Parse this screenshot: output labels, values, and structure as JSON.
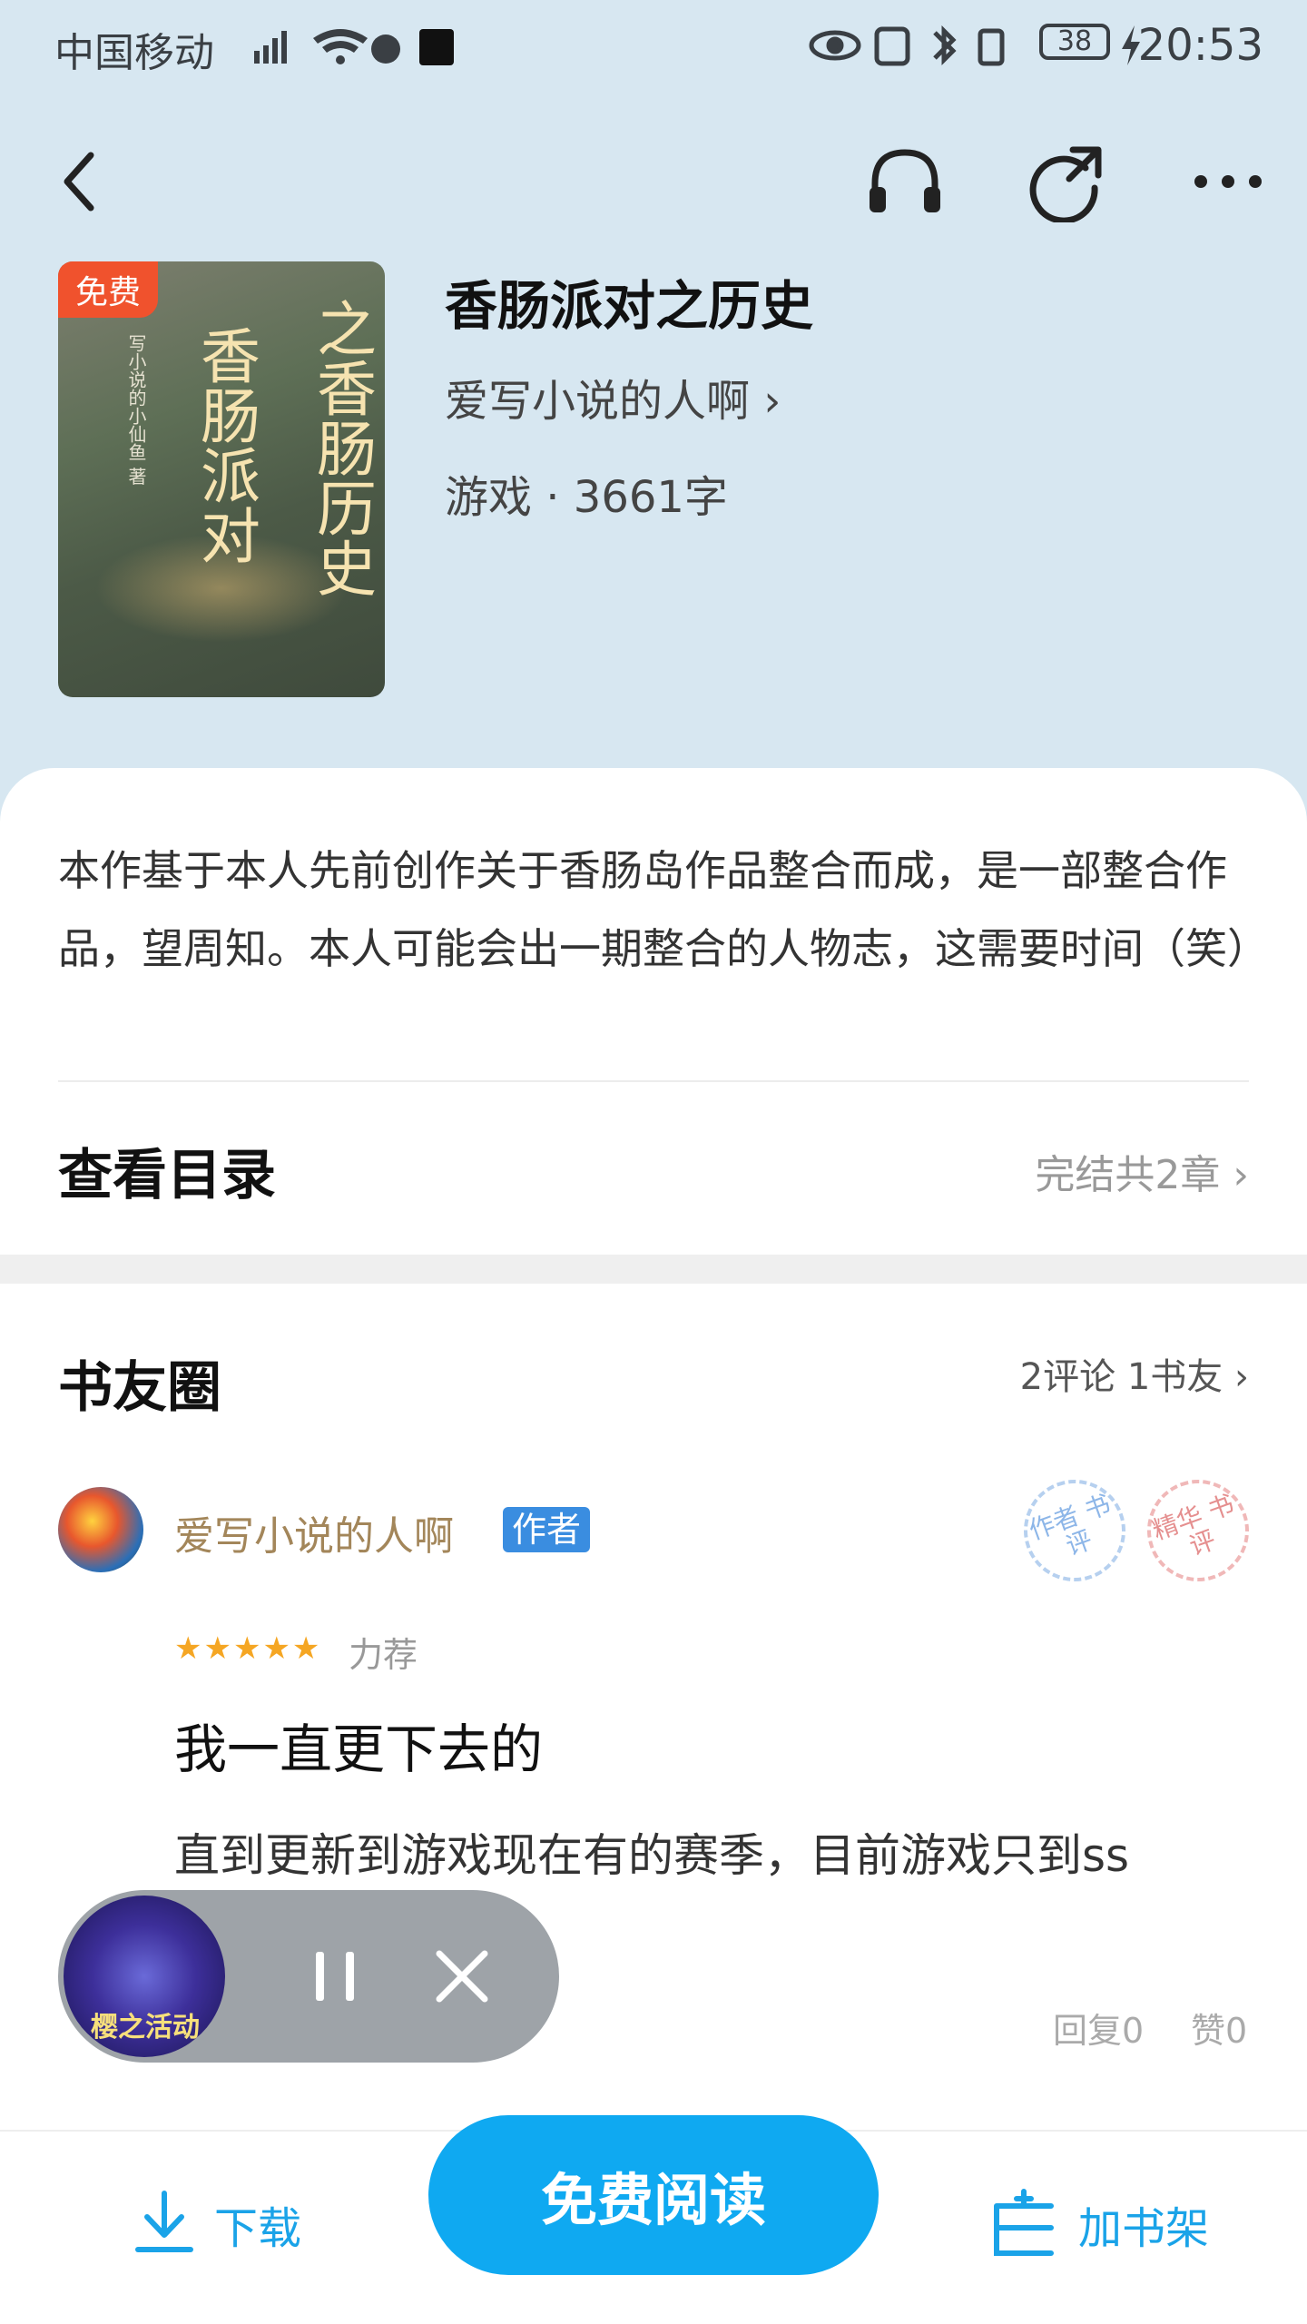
{
  "status_bar": {
    "carrier": "中国移动",
    "battery": "38",
    "time": "20:53"
  },
  "book": {
    "badge": "免费",
    "cover_title_a": "之香肠历史",
    "cover_title_b": "香肠派对",
    "cover_author": "写小说的小仙鱼 著",
    "title": "香肠派对之历史",
    "author": "爱写小说的人啊 ›",
    "meta": "游戏 · 3661字"
  },
  "intro": "本作基于本人先前创作关于香肠岛作品整合而成，是一部整合作品，望周知。本人可能会出一期整合的人物志，这需要时间（笑）",
  "catalog": {
    "title": "查看目录",
    "info": "完结共2章 ›"
  },
  "circle": {
    "title": "书友圈",
    "info": "2评论 1书友 ›"
  },
  "comment": {
    "author": "爱写小说的人啊",
    "author_tag": "作者",
    "stamp_blue": "作者 书评",
    "stamp_red": "精华 书评",
    "stars": "★★★★★",
    "recommend": "力荐",
    "title": "我一直更下去的",
    "body": "直到更新到游戏现在有的赛季，目前游戏只到ss",
    "replies": "回复0",
    "likes": "赞0"
  },
  "player": {
    "thumb_text": "樱之活动"
  },
  "bottom": {
    "download": "下载",
    "read": "免费阅读",
    "add_shelf": "加书架"
  },
  "icons": {
    "back": "back-icon",
    "listen": "headphones-icon",
    "share": "share-icon",
    "more": "more-icon",
    "pause": "pause-icon",
    "close": "close-icon",
    "download": "download-icon",
    "shelf": "bookshelf-icon"
  },
  "colors": {
    "header_bg": "#d7e7f1",
    "accent": "#0fa9f1",
    "free_badge": "#f0522d",
    "author_name": "#a3865a"
  }
}
